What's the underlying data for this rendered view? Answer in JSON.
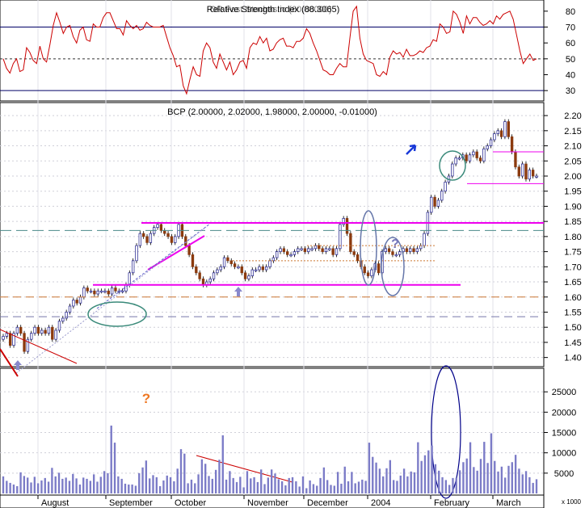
{
  "chart_data": [
    {
      "type": "line",
      "panel": "rsi",
      "title": "Relative Strength Index (88.3065)",
      "overlay_title": "OR Fast Stochastic (60.00000)",
      "ylim": [
        25,
        85
      ],
      "yticks": [
        30,
        40,
        50,
        60,
        70,
        80
      ],
      "reference_lines": [
        30,
        50,
        70
      ],
      "line_color": "#cc0000",
      "series": [
        {
          "values": [
            50,
            44,
            41,
            47,
            50,
            42,
            43,
            57,
            54,
            49,
            47,
            58,
            50,
            48,
            59,
            71,
            79,
            73,
            66,
            70,
            71,
            64,
            60,
            68,
            70,
            62,
            61,
            72,
            70,
            70,
            76,
            79,
            79,
            74,
            69,
            69,
            65,
            74,
            71,
            69,
            71,
            68,
            69,
            73,
            71,
            70,
            70,
            70,
            71,
            64,
            57,
            52,
            45,
            46,
            33,
            28,
            37,
            45,
            40,
            39,
            55,
            60,
            57,
            48,
            44,
            53,
            48,
            43,
            48,
            40,
            43,
            48,
            49,
            44,
            57,
            60,
            59,
            64,
            60,
            63,
            55,
            56,
            60,
            62,
            63,
            58,
            58,
            57,
            61,
            61,
            63,
            69,
            66,
            60,
            55,
            49,
            43,
            42,
            40,
            40,
            44,
            47,
            45,
            45,
            63,
            80,
            83,
            63,
            53,
            49,
            48,
            47,
            40,
            39,
            42,
            40,
            51,
            55,
            53,
            54,
            51,
            56,
            52,
            52,
            53,
            55,
            54,
            57,
            58,
            62,
            61,
            72,
            70,
            66,
            67,
            80,
            78,
            73,
            66,
            77,
            72,
            76,
            76,
            73,
            71,
            72,
            74,
            72,
            77,
            75,
            78,
            79,
            80,
            75,
            65,
            55,
            47,
            50,
            53,
            49,
            50
          ]
        }
      ]
    },
    {
      "type": "candlestick",
      "panel": "price",
      "title": "BCP (2.00000, 2.02000, 1.98000, 2.00000, -0.01000)",
      "ylim": [
        1.375,
        2.235
      ],
      "yticks": [
        1.4,
        1.45,
        1.5,
        1.55,
        1.6,
        1.65,
        1.7,
        1.75,
        1.8,
        1.85,
        1.9,
        1.95,
        2.0,
        2.05,
        2.1,
        2.15,
        2.2
      ],
      "up_color": "#ffffff",
      "down_color": "#8b3a0e",
      "close": [
        1.47,
        1.48,
        1.44,
        1.48,
        1.5,
        1.48,
        1.42,
        1.46,
        1.48,
        1.5,
        1.48,
        1.49,
        1.48,
        1.5,
        1.46,
        1.49,
        1.52,
        1.53,
        1.55,
        1.57,
        1.59,
        1.58,
        1.6,
        1.63,
        1.62,
        1.62,
        1.61,
        1.62,
        1.62,
        1.62,
        1.61,
        1.63,
        1.62,
        1.62,
        1.62,
        1.64,
        1.68,
        1.72,
        1.77,
        1.81,
        1.8,
        1.78,
        1.81,
        1.83,
        1.84,
        1.82,
        1.81,
        1.8,
        1.78,
        1.8,
        1.84,
        1.8,
        1.77,
        1.74,
        1.7,
        1.68,
        1.66,
        1.64,
        1.65,
        1.66,
        1.68,
        1.69,
        1.7,
        1.73,
        1.72,
        1.71,
        1.7,
        1.7,
        1.68,
        1.66,
        1.67,
        1.69,
        1.69,
        1.7,
        1.69,
        1.7,
        1.72,
        1.73,
        1.75,
        1.76,
        1.75,
        1.74,
        1.74,
        1.75,
        1.76,
        1.76,
        1.75,
        1.76,
        1.76,
        1.77,
        1.76,
        1.75,
        1.76,
        1.76,
        1.74,
        1.76,
        1.84,
        1.86,
        1.81,
        1.75,
        1.74,
        1.72,
        1.7,
        1.68,
        1.67,
        1.69,
        1.71,
        1.68,
        1.75,
        1.76,
        1.75,
        1.74,
        1.74,
        1.75,
        1.76,
        1.75,
        1.76,
        1.75,
        1.76,
        1.77,
        1.81,
        1.88,
        1.93,
        1.9,
        1.92,
        1.95,
        1.98,
        2.0,
        2.04,
        2.06,
        2.06,
        2.07,
        2.05,
        2.07,
        2.08,
        2.06,
        2.05,
        2.09,
        2.1,
        2.12,
        2.14,
        2.15,
        2.13,
        2.18,
        2.13,
        2.08,
        2.03,
        2.0,
        2.04,
        1.99,
        2.02,
        2.0,
        2.0
      ],
      "annotations": {
        "horizontal_lines": [
          1.535,
          1.6,
          1.82,
          1.845,
          1.64,
          1.72,
          1.77,
          2.08,
          1.975
        ],
        "question_marks": 2
      }
    },
    {
      "type": "bar",
      "panel": "volume",
      "yticks": [
        5000,
        10000,
        15000,
        20000,
        25000
      ],
      "scale_label": "x 1000",
      "ylim": [
        0,
        30000
      ],
      "bar_color": "#7b7bc7",
      "values": [
        4200,
        3100,
        2600,
        2200,
        1800,
        5200,
        4300,
        3900,
        2700,
        4100,
        2500,
        3200,
        3800,
        2900,
        6300,
        4200,
        5100,
        3600,
        3900,
        3100,
        4800,
        3700,
        2200,
        3900,
        3600,
        3100,
        4700,
        2900,
        4100,
        5500,
        5000,
        16700,
        12500,
        4200,
        3600,
        2400,
        2200,
        2200,
        1900,
        5000,
        6400,
        8100,
        3700,
        4500,
        4000,
        1800,
        3200,
        4400,
        4000,
        3000,
        6100,
        10900,
        9800,
        2500,
        3400,
        2500,
        4700,
        8400,
        7300,
        4300,
        3600,
        5800,
        8300,
        14300,
        3400,
        5500,
        3800,
        2800,
        4100,
        1500,
        5500,
        3700,
        4000,
        2800,
        5900,
        2300,
        3900,
        5900,
        4900,
        3500,
        3000,
        2000,
        3800,
        4000,
        3000,
        1700,
        4200,
        1300,
        3200,
        2300,
        1900,
        3800,
        6400,
        3300,
        2100,
        1900,
        5300,
        2400,
        6600,
        3000,
        5300,
        2500,
        2900,
        3400,
        3100,
        12500,
        9000,
        7600,
        6100,
        4200,
        6200,
        8200,
        3300,
        3100,
        4400,
        6100,
        4200,
        5400,
        5200,
        12600,
        8000,
        9400,
        10600,
        11800,
        7200,
        5600,
        4000,
        3300,
        2100,
        3800,
        3800,
        5700,
        7700,
        8600,
        12600,
        6500,
        5600,
        8500,
        12700,
        7500,
        14800,
        8000,
        5400,
        6600,
        3900,
        6800,
        7700,
        9500,
        6100,
        4700,
        5500,
        4000,
        2600,
        3500
      ],
      "annotations": {
        "question_marks": 1
      }
    }
  ],
  "x_axis": {
    "labels": [
      "August",
      "September",
      "October",
      "November",
      "December",
      "2004",
      "February",
      "March"
    ]
  }
}
